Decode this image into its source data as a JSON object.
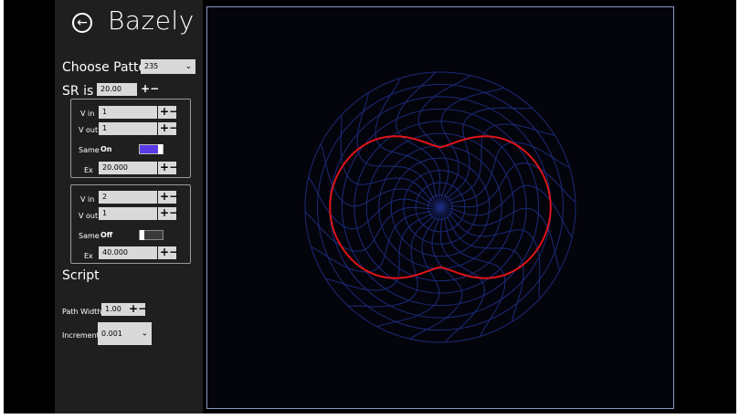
{
  "app": {
    "title": "Bazely"
  },
  "pattern": {
    "label": "Choose Pattern",
    "value": "235"
  },
  "sr": {
    "label": "SR is",
    "value": "20.00"
  },
  "group1": {
    "vin_label": "V in",
    "vin_value": "1",
    "vout_label": "V out",
    "vout_value": "1",
    "same_label": "Same",
    "same_state": "On",
    "ex_label": "Ex",
    "ex_value": "20.000"
  },
  "group2": {
    "vin_label": "V in",
    "vin_value": "2",
    "vout_label": "V out",
    "vout_value": "1",
    "same_label": "Same",
    "same_state": "Off",
    "ex_label": "Ex",
    "ex_value": "40.000"
  },
  "script": {
    "label": "Script"
  },
  "path_width": {
    "label": "Path Width",
    "value": "1.00"
  },
  "increment": {
    "label": "Increment",
    "value": "0.001"
  },
  "controls": {
    "plus": "+",
    "minus": "−"
  },
  "colors": {
    "grid": "#1c2a78",
    "curve": "#e01418",
    "accent": "#5b3be8"
  }
}
